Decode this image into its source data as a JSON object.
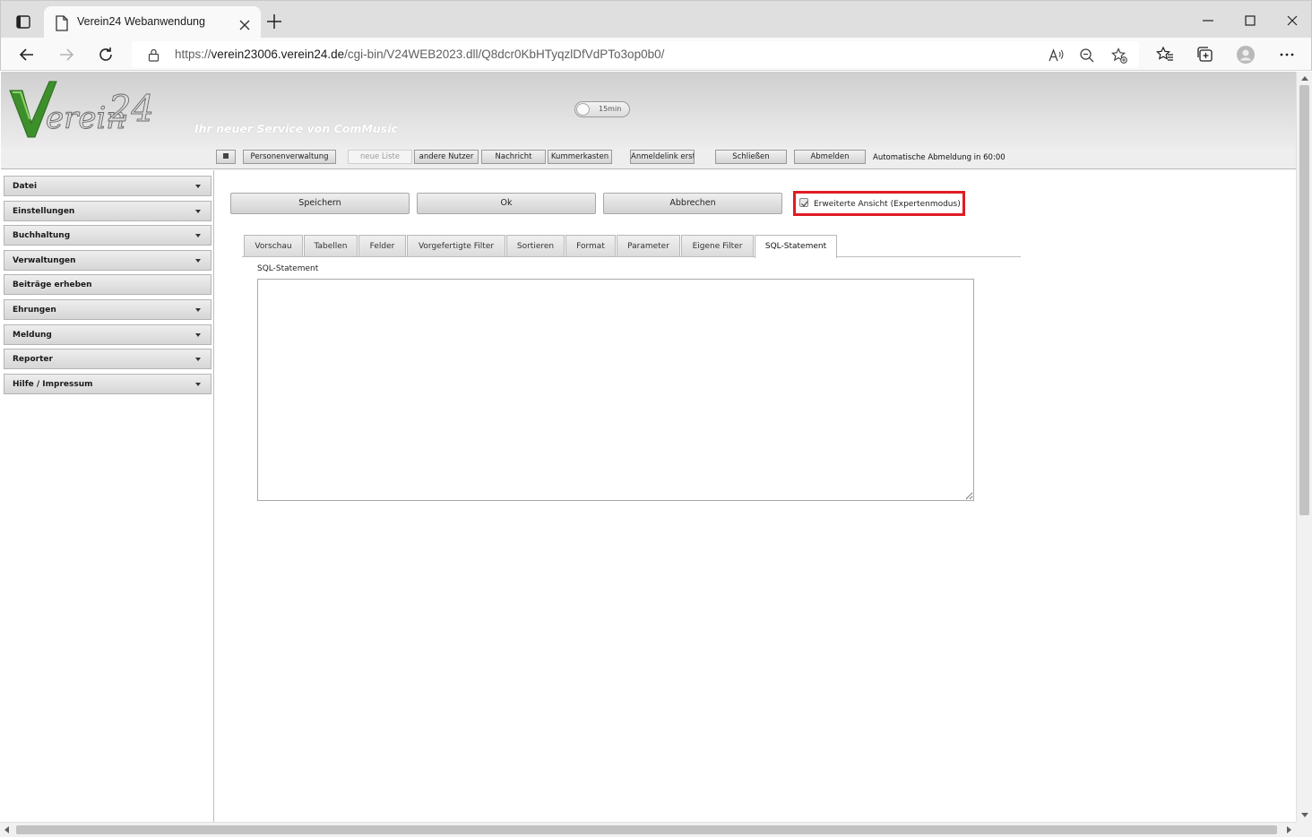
{
  "browser": {
    "tab_title": "Verein24 Webanwendung",
    "url_prefix": "https://",
    "url_host": "verein23006.verein24.de",
    "url_path": "/cgi-bin/V24WEB2023.dll/Q8dcr0KbHTyqzlDfVdPTo3op0b0/"
  },
  "header": {
    "logo_text": "Verein 24",
    "tagline": "Ihr neuer Service von ComMusic",
    "timer_label": "15min"
  },
  "toolbar": {
    "buttons": [
      {
        "label": "Personenverwaltung"
      },
      {
        "label": "neue Liste"
      },
      {
        "label": "andere Nutzer"
      },
      {
        "label": "Nachricht"
      },
      {
        "label": "Kummerkasten"
      },
      {
        "label": "Anmeldelink erst"
      },
      {
        "label": "Schließen"
      },
      {
        "label": "Abmelden"
      }
    ],
    "auto_logout": "Automatische Abmeldung in 60:00"
  },
  "sidebar": {
    "items": [
      {
        "label": "Datei",
        "has_dropdown": true
      },
      {
        "label": "Einstellungen",
        "has_dropdown": true
      },
      {
        "label": "Buchhaltung",
        "has_dropdown": true
      },
      {
        "label": "Verwaltungen",
        "has_dropdown": true
      },
      {
        "label": "Beiträge erheben",
        "has_dropdown": false
      },
      {
        "label": "Ehrungen",
        "has_dropdown": true
      },
      {
        "label": "Meldung",
        "has_dropdown": true
      },
      {
        "label": "Reporter",
        "has_dropdown": true
      },
      {
        "label": "Hilfe / Impressum",
        "has_dropdown": true
      }
    ]
  },
  "main": {
    "actions": {
      "save": "Speichern",
      "ok": "Ok",
      "cancel": "Abbrechen"
    },
    "expert_mode": {
      "label": "Erweiterte Ansicht (Expertenmodus)",
      "checked": true,
      "highlight_color": "#e01b24"
    },
    "tabs": [
      {
        "label": "Vorschau"
      },
      {
        "label": "Tabellen"
      },
      {
        "label": "Felder"
      },
      {
        "label": "Vorgefertigte Filter"
      },
      {
        "label": "Sortieren"
      },
      {
        "label": "Format"
      },
      {
        "label": "Parameter"
      },
      {
        "label": "Eigene Filter"
      },
      {
        "label": "SQL-Statement",
        "active": true
      }
    ],
    "sql": {
      "label": "SQL-Statement",
      "value": ""
    }
  }
}
